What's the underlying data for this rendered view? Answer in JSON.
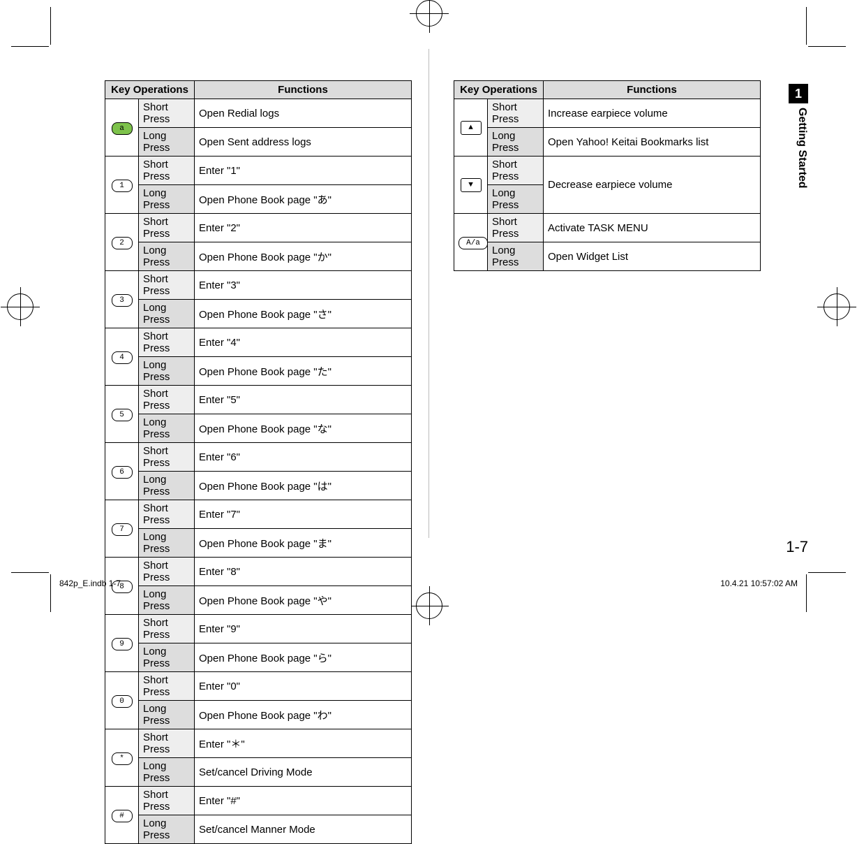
{
  "headers": {
    "key_ops": "Key Operations",
    "functions": "Functions",
    "short": "Short Press",
    "long": "Long Press"
  },
  "left_table": [
    {
      "key": "a",
      "key_style": "green",
      "short": "Open Redial logs",
      "long": "Open Sent address logs"
    },
    {
      "key": "1",
      "short": "Enter \"1\"",
      "long": "Open Phone Book page \"あ\""
    },
    {
      "key": "2",
      "short": "Enter \"2\"",
      "long": "Open Phone Book page \"か\""
    },
    {
      "key": "3",
      "short": "Enter \"3\"",
      "long": "Open Phone Book page \"さ\""
    },
    {
      "key": "4",
      "short": "Enter \"4\"",
      "long": "Open Phone Book page \"た\""
    },
    {
      "key": "5",
      "short": "Enter \"5\"",
      "long": "Open Phone Book page \"な\""
    },
    {
      "key": "6",
      "short": "Enter \"6\"",
      "long": "Open Phone Book page \"は\""
    },
    {
      "key": "7",
      "short": "Enter \"7\"",
      "long": "Open Phone Book page \"ま\""
    },
    {
      "key": "8",
      "short": "Enter \"8\"",
      "long": "Open Phone Book page \"や\""
    },
    {
      "key": "9",
      "short": "Enter \"9\"",
      "long": "Open Phone Book page \"ら\""
    },
    {
      "key": "0",
      "short": "Enter \"0\"",
      "long": "Open Phone Book page \"わ\""
    },
    {
      "key": "*",
      "short": "Enter \"＊\"",
      "long": "Set/cancel Driving Mode"
    },
    {
      "key": "#",
      "short": "Enter \"#\"",
      "long": "Set/cancel Manner Mode"
    }
  ],
  "right_table": [
    {
      "key": "▲",
      "key_style": "small",
      "short": "Increase earpiece volume",
      "long": "Open Yahoo! Keitai Bookmarks list"
    },
    {
      "key": "▼",
      "key_style": "small",
      "short": "Decrease earpiece volume",
      "long": "",
      "merged": true,
      "merged_text": "Decrease earpiece volume"
    },
    {
      "key": "A/a",
      "key_style": "wide",
      "short": "Activate TASK MENU",
      "long": "Open Widget List"
    }
  ],
  "chapter_number": "1",
  "chapter_title": "Getting Started",
  "page_number": "1-7",
  "footer_filename": "842p_E.indb   1-7",
  "footer_timestamp": "10.4.21   10:57:02 AM"
}
